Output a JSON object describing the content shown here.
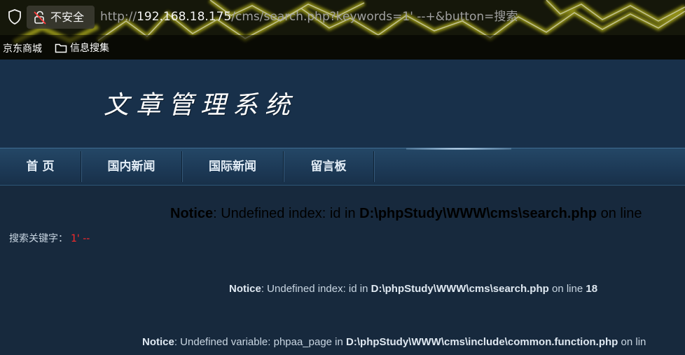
{
  "browser": {
    "security_label": "不安全",
    "url_host_prefix": "http://",
    "url_host": "192.168.18.175",
    "url_rest": "/cms/search.php?keywords=1' --+&button=搜索",
    "bookmarks": [
      "京东商城",
      "信息搜集"
    ],
    "icons": {
      "shield": "shield-icon",
      "lock": "lock-broken-icon",
      "folder": "folder-icon"
    }
  },
  "site": {
    "logo": "文章管理系统",
    "nav": [
      "首 页",
      "国内新闻",
      "国际新闻",
      "留言板"
    ]
  },
  "content": {
    "notice1": {
      "label": "Notice",
      "msg": ": Undefined index: id in ",
      "path": "D:\\phpStudy\\WWW\\cms\\search.php",
      "tail": " on line"
    },
    "search_label": "搜索关键字：",
    "search_value": "1' --",
    "notice2": {
      "label": "Notice",
      "msg": ": Undefined index: id in ",
      "path": "D:\\phpStudy\\WWW\\cms\\search.php",
      "mid": " on line ",
      "line": "18"
    },
    "notice3": {
      "label": "Notice",
      "msg": ": Undefined variable: phpaa_page in ",
      "path": "D:\\phpStudy\\WWW\\cms\\include\\common.function.php",
      "tail": " on lin"
    }
  },
  "colors": {
    "page_bg": "#17293d",
    "header_bg": "#18304a",
    "keyword": "#ff2a2a"
  }
}
